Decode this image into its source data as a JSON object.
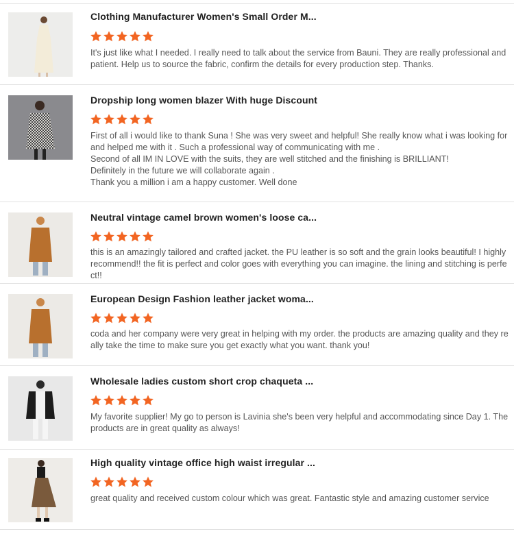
{
  "colors": {
    "star": "#f26522",
    "divider": "#e2e2e2",
    "title": "#222222",
    "body": "#555555"
  },
  "reviews": [
    {
      "title": "Clothing Manufacturer Women's Small Order M...",
      "rating": 5,
      "text": "It's just like what I needed. I really need to talk about the service from Bauni. They are really professional and patient. Help us to source the fabric, confirm the details for every production step. Thanks.",
      "image": "cream-slip-dress-photo"
    },
    {
      "title": "Dropship long women blazer With huge Discount",
      "rating": 5,
      "lines": [
        "First of all i would like to thank Suna ! She was very sweet and helpful! She really know what i was looking for and helped me with it . Such a professional way of communicating with me .",
        "Second of all IM IN LOVE with the suits, they are well stitched and the finishing is BRILLIANT!",
        "Definitely in the future we will collaborate again .",
        "Thank you a million i am a happy customer. Well done"
      ],
      "image": "houndstooth-blazer-photo"
    },
    {
      "title": "Neutral vintage camel brown women's loose ca...",
      "rating": 5,
      "text": "this is an amazingly tailored and crafted jacket. the PU leather is so soft and the grain looks beautiful! I highly recommend!! the fit is perfect and color goes with everything you can imagine. the lining and stitching is perfect!!",
      "image": "camel-leather-jacket-photo"
    },
    {
      "title": "European Design Fashion leather jacket woma...",
      "rating": 5,
      "text": "coda and her company were very great in helping with my order. the products are amazing quality and they really take the time to make sure you get exactly what you want. thank you!",
      "image": "camel-leather-jacket-photo"
    },
    {
      "title": "Wholesale ladies custom short crop chaqueta ...",
      "rating": 5,
      "text": "My favorite supplier! My go to person is Lavinia she's been very helpful and accommodating since Day 1. The products are in great quality as always!",
      "image": "black-leather-jacket-photo"
    },
    {
      "title": "High quality vintage office high waist irregular ...",
      "rating": 5,
      "text": "great quality and received custom colour which was great. Fantastic style and amazing customer service",
      "image": "brown-skirt-photo"
    }
  ]
}
